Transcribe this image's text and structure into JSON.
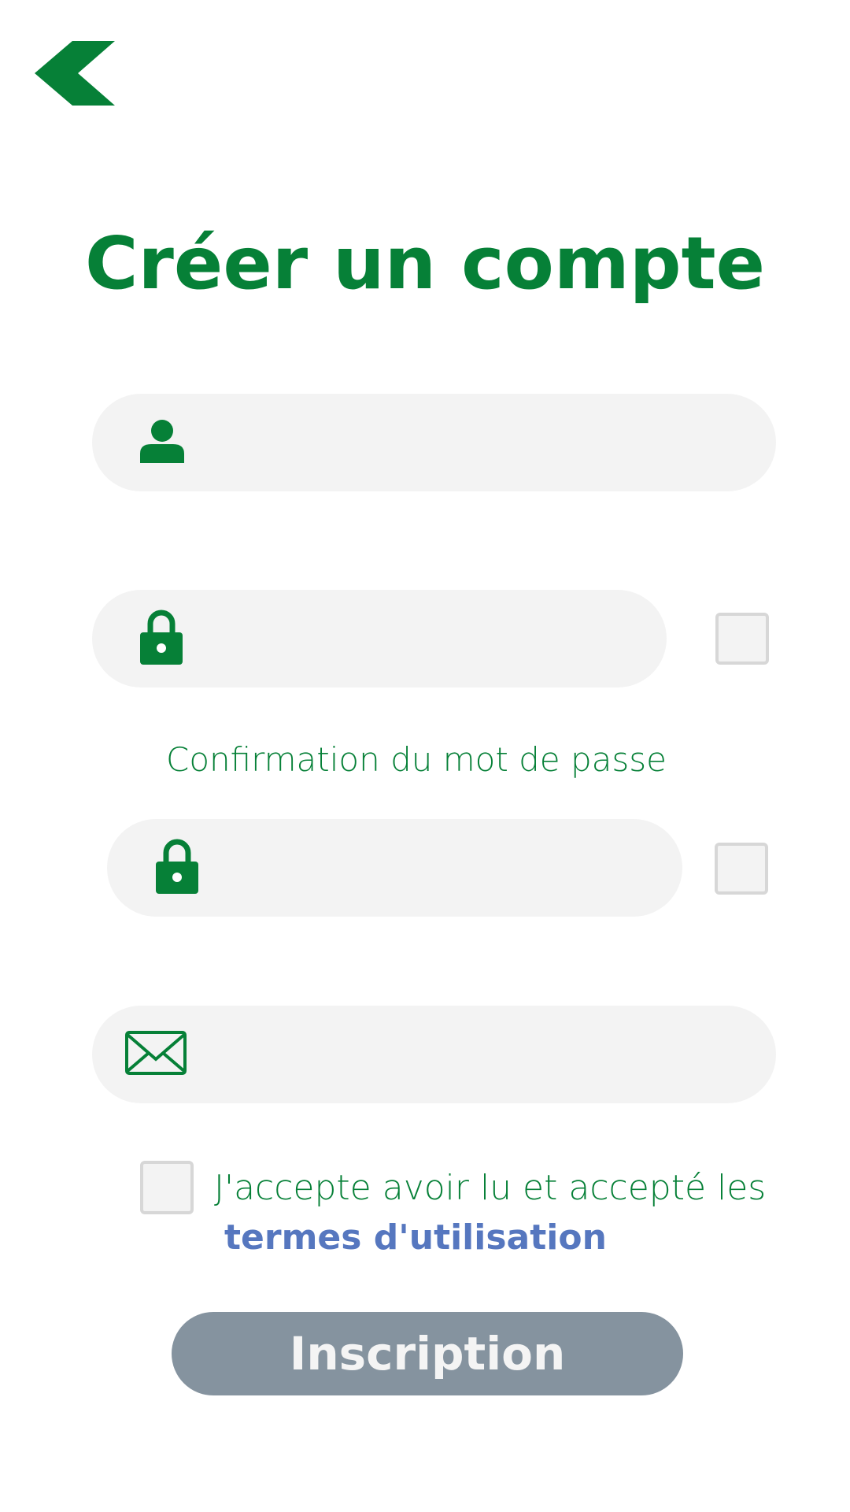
{
  "colors": {
    "primary": "#068037",
    "link": "#5677bf",
    "field_bg": "#f3f3f3",
    "button_disabled": "#85939f"
  },
  "header": {
    "back_icon": "chevron-left-icon",
    "title": "Créer un compte"
  },
  "form": {
    "username": {
      "icon": "user-icon",
      "value": "",
      "placeholder": ""
    },
    "password": {
      "icon": "lock-icon",
      "value": "",
      "placeholder": "",
      "show_checked": false
    },
    "confirm_label": "Confirmation du mot de passe",
    "password_confirm": {
      "icon": "lock-icon",
      "value": "",
      "placeholder": "",
      "show_checked": false
    },
    "email": {
      "icon": "envelope-icon",
      "value": "",
      "placeholder": ""
    },
    "terms": {
      "checked": false,
      "text": "J'accepte avoir lu et accepté les",
      "link": "termes d'utilisation"
    },
    "submit_label": "Inscription"
  }
}
